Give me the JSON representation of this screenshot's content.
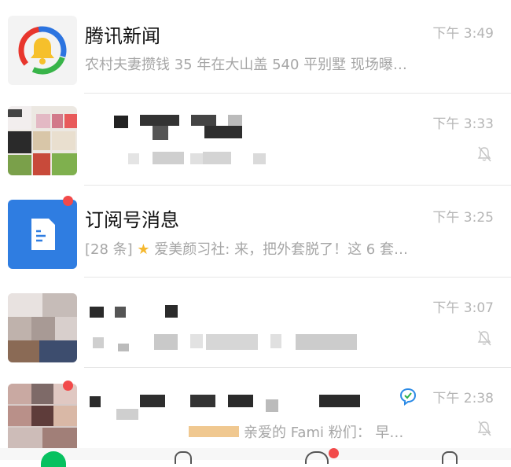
{
  "colors": {
    "accent_red": "#f24a4a",
    "subscription_blue": "#2f7de1",
    "star_gold": "#f5b82e",
    "wechat_green": "#07c160",
    "read_receipt_blue": "#2b8ae6"
  },
  "chats": [
    {
      "title": "腾讯新闻",
      "preview": "农村夫妻攒钱 35 年在大山盖 540 平别墅 现场曝…",
      "time": "下午 3:49",
      "avatar_icon": "tencent-news-logo-icon",
      "muted": false
    },
    {
      "title": "",
      "preview": "",
      "time": "下午 3:33",
      "avatar_icon": "blurred-avatar",
      "muted": true
    },
    {
      "title": "订阅号消息",
      "preview_count": "[28 条]",
      "preview_star": "★",
      "preview": "爱美颜习社: 来，把外套脱了！这 6 套…",
      "time": "下午 3:25",
      "avatar_icon": "subscription-document-icon",
      "unread_dot": true,
      "muted": false
    },
    {
      "title": "",
      "preview": "",
      "time": "下午 3:07",
      "avatar_icon": "blurred-avatar",
      "muted": true
    },
    {
      "title": "",
      "preview": "亲爱的 Fami 粉们：  早…",
      "time": "下午 2:38",
      "avatar_icon": "blurred-group-avatar",
      "unread_dot": true,
      "muted": true
    }
  ]
}
